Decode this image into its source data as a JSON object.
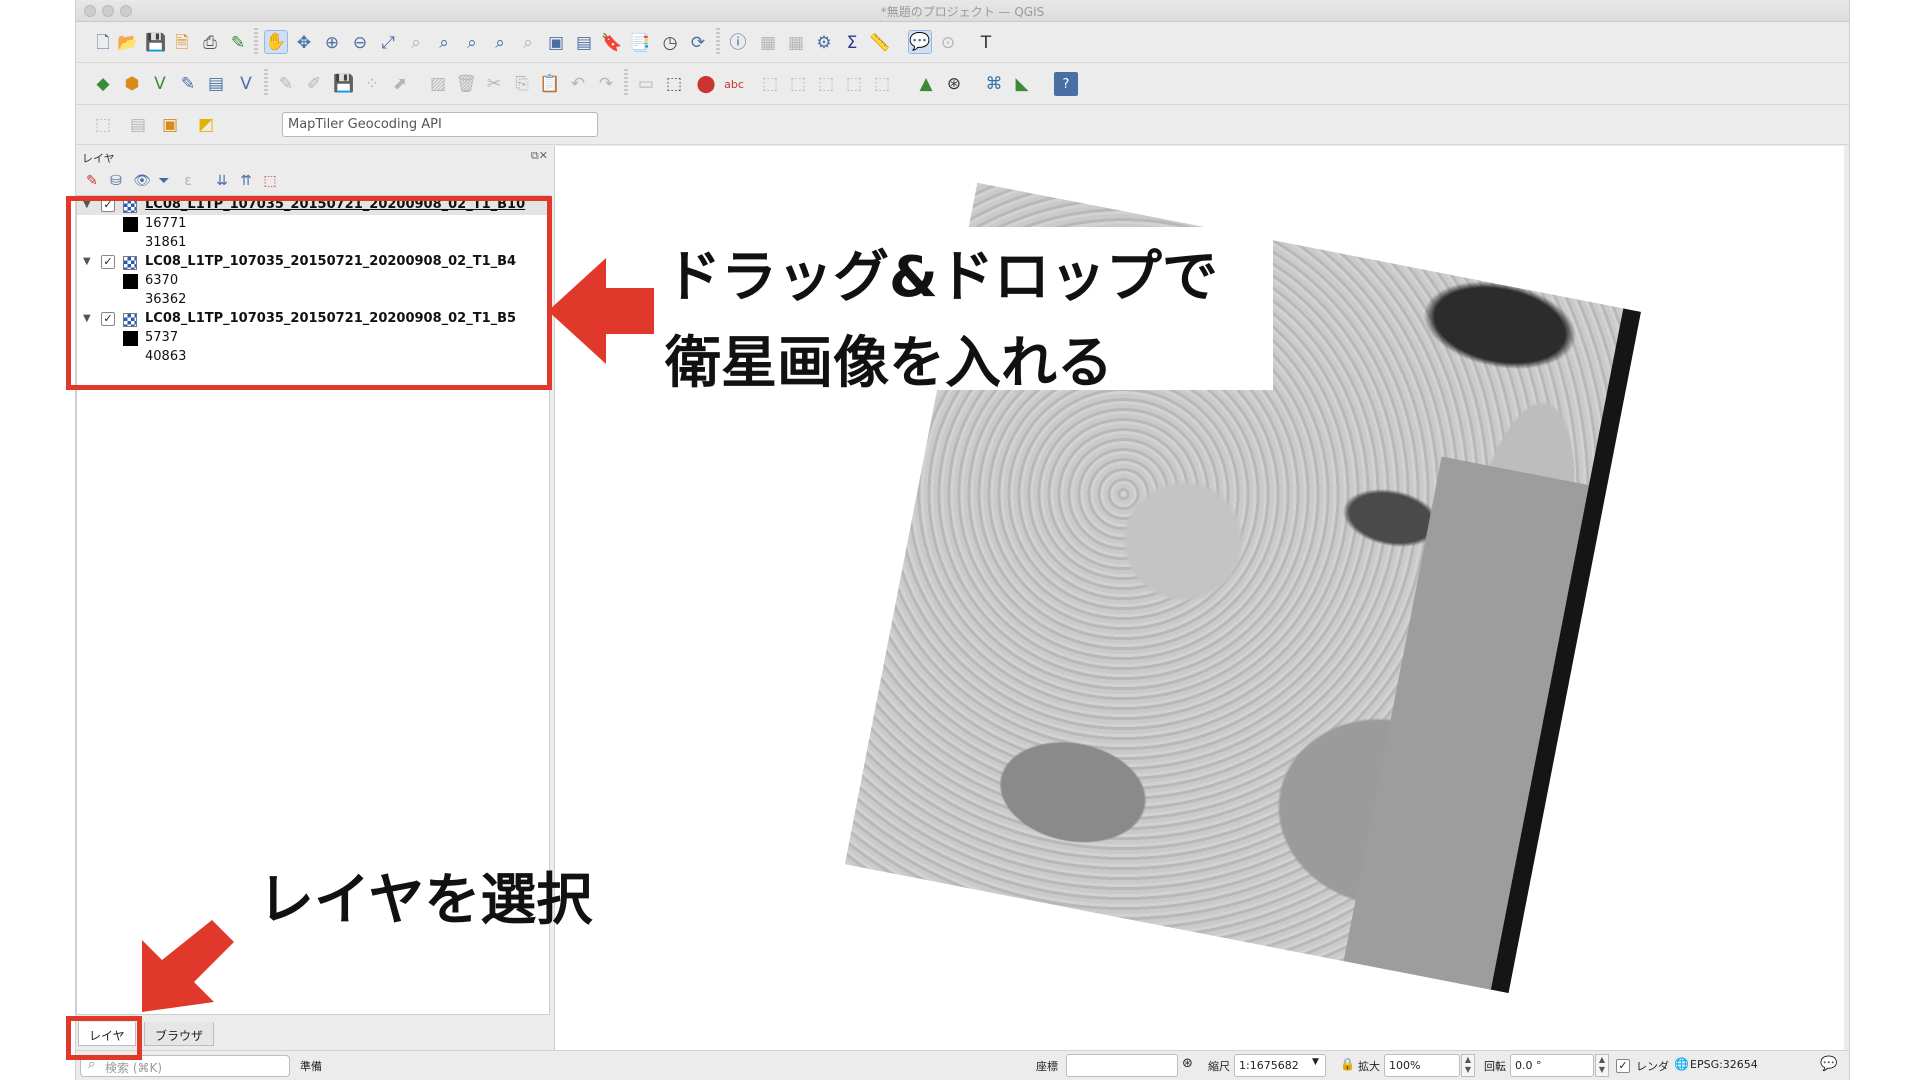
{
  "window": {
    "title": "*無題のプロジェクト — QGIS"
  },
  "toolbar": {
    "row1_icons": [
      "new-project-icon",
      "open-project-icon",
      "save-project-icon",
      "save-as-icon",
      "print-layout-icon",
      "style-manager-icon",
      "pan-icon",
      "pan-to-selection-icon",
      "zoom-in-icon",
      "zoom-out-icon",
      "zoom-full-icon",
      "zoom-to-selection-icon",
      "zoom-to-layer-icon",
      "zoom-native-icon",
      "zoom-last-icon",
      "zoom-next-icon",
      "new-map-view-icon",
      "new-3d-view-icon",
      "new-bookmark-icon",
      "show-bookmarks-icon",
      "temporal-controller-icon",
      "refresh-icon",
      "identify-icon",
      "attribute-table-icon",
      "field-calculator-icon",
      "processing-toolbox-icon",
      "statistics-icon",
      "measure-icon",
      "map-tips-icon",
      "annotation-icon",
      "text-annotation-icon"
    ],
    "row2_icons": [
      "data-source-manager-icon",
      "new-geopackage-icon",
      "new-shapefile-icon",
      "digitize-icon",
      "new-virtual-layer-icon",
      "add-vector-layer-icon",
      "current-edits-icon",
      "toggle-editing-icon",
      "save-edits-icon",
      "add-feature-icon",
      "vertex-tool-icon",
      "modify-attributes-icon",
      "delete-selected-icon",
      "cut-features-icon",
      "copy-features-icon",
      "paste-features-icon",
      "undo-icon",
      "redo-icon",
      "label-tool-icon",
      "pin-labels-icon",
      "highlight-labels-icon",
      "show-labels-icon",
      "move-label-icon",
      "rotate-label-icon",
      "change-label-icon",
      "label-props-icon",
      "georeferencer-icon",
      "gps-icon",
      "python-icon",
      "profile-tool-icon",
      "help-icon"
    ],
    "geocoder_placeholder": "MapTiler Geocoding API"
  },
  "panel": {
    "title": "レイヤ",
    "layers": [
      {
        "name": "LC08_L1TP_107035_20150721_20200908_02_T1_B10",
        "checked": true,
        "values": [
          "16771",
          "31861"
        ]
      },
      {
        "name": "LC08_L1TP_107035_20150721_20200908_02_T1_B4",
        "checked": true,
        "values": [
          "6370",
          "36362"
        ]
      },
      {
        "name": "LC08_L1TP_107035_20150721_20200908_02_T1_B5",
        "checked": true,
        "values": [
          "5737",
          "40863"
        ]
      }
    ],
    "tabs": [
      "レイヤ",
      "ブラウザ"
    ]
  },
  "annotations": {
    "top_line1": "ドラッグ&ドロップで",
    "top_line2": "衛星画像を入れる",
    "bottom": "レイヤを選択",
    "accent_color": "#e0392b"
  },
  "status": {
    "search_placeholder": "検索 (⌘K)",
    "ready": "準備",
    "coord_label": "座標",
    "scale_label": "縮尺",
    "scale_value": "1:1675682",
    "magnify_label": "拡大",
    "magnify_value": "100%",
    "rotation_label": "回転",
    "rotation_value": "0.0 °",
    "render_label": "レンダ",
    "crs": "EPSG:32654"
  }
}
